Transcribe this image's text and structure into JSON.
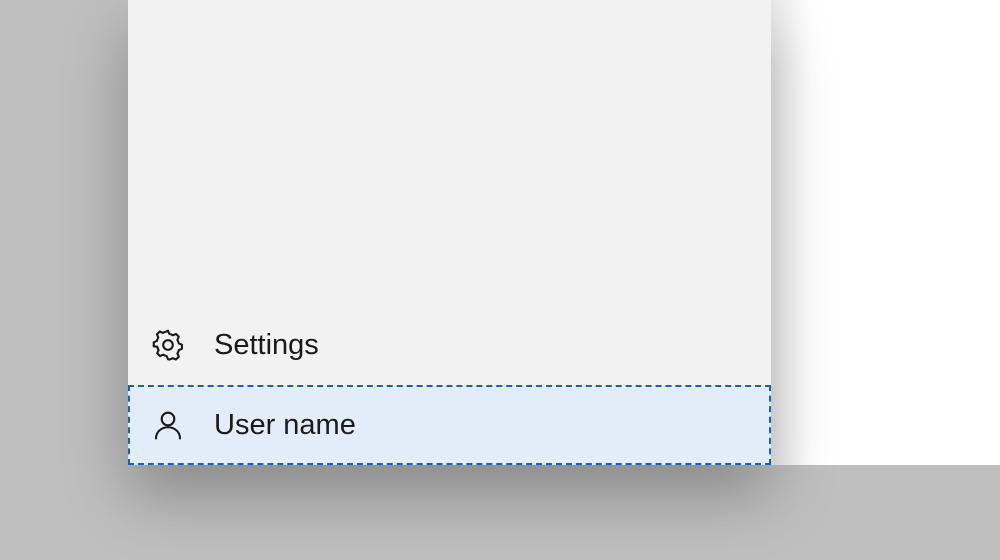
{
  "items": {
    "settings": {
      "label": "Settings"
    },
    "user": {
      "label": "User name"
    }
  }
}
